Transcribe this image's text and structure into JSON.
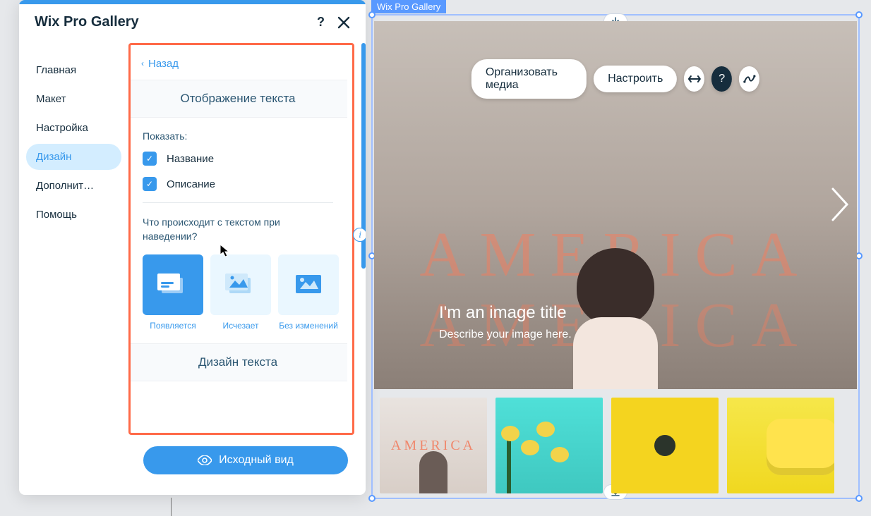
{
  "panel": {
    "title": "Wix Pro Gallery",
    "back": "Назад",
    "sidebar": {
      "items": [
        {
          "label": "Главная"
        },
        {
          "label": "Макет"
        },
        {
          "label": "Настройка"
        },
        {
          "label": "Дизайн"
        },
        {
          "label": "Дополнит…"
        },
        {
          "label": "Помощь"
        }
      ],
      "active_index": 3
    },
    "section_text_display": {
      "title": "Отображение текста",
      "show_label": "Показать:",
      "checkboxes": {
        "title": {
          "label": "Название",
          "checked": true
        },
        "description": {
          "label": "Описание",
          "checked": true
        }
      },
      "hover_question": "Что происходит с текстом при наведении?",
      "options": [
        {
          "label": "Появляется"
        },
        {
          "label": "Исчезает"
        },
        {
          "label": "Без изменений"
        }
      ],
      "selected_option": 0
    },
    "section_text_design": {
      "title": "Дизайн текста"
    },
    "preview_button": "Исходный вид"
  },
  "canvas": {
    "tag": "Wix Pro Gallery",
    "toolbar": {
      "organize": "Организовать медиа",
      "settings": "Настроить"
    },
    "hero": {
      "title": "I'm an image title",
      "description": "Describe your image here.",
      "neon_text": "AMERICA"
    }
  }
}
